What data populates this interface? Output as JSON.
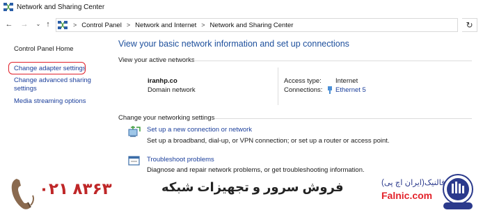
{
  "window": {
    "title": "Network and Sharing Center",
    "app_icon": "network-sharing-icon"
  },
  "nav": {
    "back_icon": "back-arrow-icon",
    "forward_icon": "forward-arrow-icon",
    "recent_icon": "chevron-down-icon",
    "up_icon": "up-arrow-icon",
    "breadcrumb": [
      "Control Panel",
      "Network and Internet",
      "Network and Sharing Center"
    ],
    "separator": ">",
    "refresh_icon": "refresh-icon"
  },
  "sidebar": {
    "items": [
      {
        "label": "Control Panel Home"
      },
      {
        "label": "Change adapter settings"
      },
      {
        "label": "Change advanced sharing"
      },
      {
        "label": "settings"
      },
      {
        "label": "Media streaming options"
      }
    ],
    "highlight_color": "#e0202a"
  },
  "main": {
    "title": "View your basic network information and set up connections",
    "active_networks_header": "View your active networks",
    "network": {
      "name": "iranhp.co",
      "type": "Domain network",
      "access_type_label": "Access type:",
      "access_type_value": "Internet",
      "connections_label": "Connections:",
      "connection_name": "Ethernet 5"
    },
    "settings_header": "Change your networking settings",
    "tasks": [
      {
        "icon": "new-connection-icon",
        "link": "Set up a new connection or network",
        "desc": "Set up a broadband, dial-up, or VPN connection; or set up a router or access point."
      },
      {
        "icon": "troubleshoot-icon",
        "link": "Troubleshoot problems",
        "desc": "Diagnose and repair network problems, or get troubleshooting information."
      }
    ]
  },
  "banner": {
    "phone": "۰۲۱ ۸۳۶۳",
    "slogan": "فروش سرور و تجهیزات شبکه",
    "brand_fa": "فالنیک(ایران اچ پی)",
    "brand_en": "Falnic.com",
    "colors": {
      "accent_red": "#bf2728",
      "brand_blue": "#2b3a8c"
    }
  }
}
